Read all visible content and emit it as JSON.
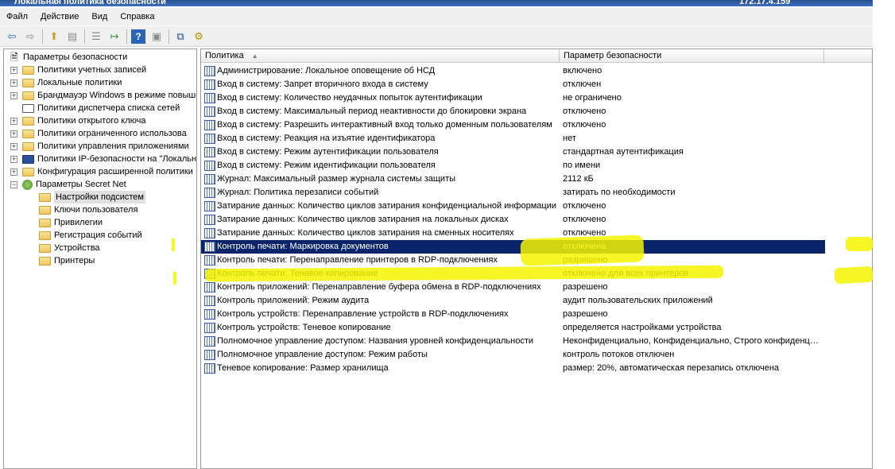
{
  "window": {
    "title": "Локальная политика безопасности",
    "ip": "172.17.4.159"
  },
  "menu": [
    "Файл",
    "Действие",
    "Вид",
    "Справка"
  ],
  "toolbar": {
    "icons": [
      "back-arrow-icon",
      "forward-arrow-icon",
      "up-folder-icon",
      "show-hide-tree-icon",
      "properties-icon",
      "export-list-icon",
      "help-icon",
      "help-topics-icon",
      "network-policy-icon",
      "filter-icon"
    ]
  },
  "tree": {
    "root": "Параметры безопасности",
    "items": [
      {
        "label": "Политики учетных записей",
        "expander": "+"
      },
      {
        "label": "Локальные политики",
        "expander": "+"
      },
      {
        "label": "Брандмауэр Windows в режиме повыше",
        "expander": "+"
      },
      {
        "label": "Политики диспетчера списка сетей",
        "expander": ""
      },
      {
        "label": "Политики открытого ключа",
        "expander": "+"
      },
      {
        "label": "Политики ограниченного использова",
        "expander": "+"
      },
      {
        "label": "Политики управления приложениями",
        "expander": "+"
      },
      {
        "label": "Политики IP-безопасности на \"Локальн",
        "expander": "+"
      },
      {
        "label": "Конфигурация расширенной политики",
        "expander": "+"
      },
      {
        "label": "Параметры Secret Net",
        "expander": "−"
      }
    ],
    "secret_net_children": [
      {
        "label": "Настройки подсистем",
        "selected": true
      },
      {
        "label": "Ключи пользователя",
        "selected": false
      },
      {
        "label": "Привилегии",
        "selected": false
      },
      {
        "label": "Регистрация событий",
        "selected": false
      },
      {
        "label": "Устройства",
        "selected": false
      },
      {
        "label": "Принтеры",
        "selected": false
      }
    ]
  },
  "list": {
    "columns": [
      "Политика",
      "Параметр безопасности"
    ],
    "rows": [
      {
        "policy": "Администрирование: Локальное оповещение об НСД",
        "value": "включено"
      },
      {
        "policy": "Вход в систему: Запрет вторичного входа в систему",
        "value": "отключен"
      },
      {
        "policy": "Вход в систему: Количество неудачных попыток аутентификации",
        "value": "не ограничено"
      },
      {
        "policy": "Вход в систему: Максимальный период неактивности до блокировки экрана",
        "value": "отключено"
      },
      {
        "policy": "Вход в систему: Разрешить интерактивный вход только доменным пользователям",
        "value": "отключено"
      },
      {
        "policy": "Вход в систему: Реакция на изъятие идентификатора",
        "value": "нет"
      },
      {
        "policy": "Вход в систему: Режим аутентификации пользователя",
        "value": "стандартная аутентификация"
      },
      {
        "policy": "Вход в систему: Режим идентификации пользователя",
        "value": "по имени"
      },
      {
        "policy": "Журнал: Максимальный размер журнала системы защиты",
        "value": "2112 кБ"
      },
      {
        "policy": "Журнал: Политика перезаписи событий",
        "value": "затирать по необходимости"
      },
      {
        "policy": "Затирание данных: Количество циклов затирания конфиденциальной информации",
        "value": "отключено"
      },
      {
        "policy": "Затирание данных: Количество циклов затирания на локальных дисках",
        "value": "отключено"
      },
      {
        "policy": "Затирание данных: Количество циклов затирания на сменных носителях",
        "value": "отключено"
      },
      {
        "policy": "Контроль печати: Маркировка документов",
        "value": "отключена",
        "selected": true
      },
      {
        "policy": "Контроль печати: Перенаправление принтеров в RDP-подключениях",
        "value": "разрешено"
      },
      {
        "policy": "Контроль печати: Теневое копирование",
        "value": "отключено для всех принтеров"
      },
      {
        "policy": "Контроль приложений: Перенаправление буфера обмена в RDP-подключениях",
        "value": "разрешено"
      },
      {
        "policy": "Контроль приложений: Режим аудита",
        "value": "аудит пользовательских приложений"
      },
      {
        "policy": "Контроль устройств: Перенаправление устройств в RDP-подключениях",
        "value": "разрешено"
      },
      {
        "policy": "Контроль устройств: Теневое копирование",
        "value": "определяется настройками устройства"
      },
      {
        "policy": "Полномочное управление доступом: Названия уровней конфиденциальности",
        "value": "Неконфиденциально, Конфиденциально, Строго конфиденц…"
      },
      {
        "policy": "Полномочное управление доступом: Режим работы",
        "value": "контроль потоков отключен"
      },
      {
        "policy": "Теневое копирование: Размер хранилища",
        "value": "размер: 20%, автоматическая перезапись отключена"
      }
    ]
  },
  "colors": {
    "selection": "#0a246a",
    "highlighter": "#f5f300"
  }
}
